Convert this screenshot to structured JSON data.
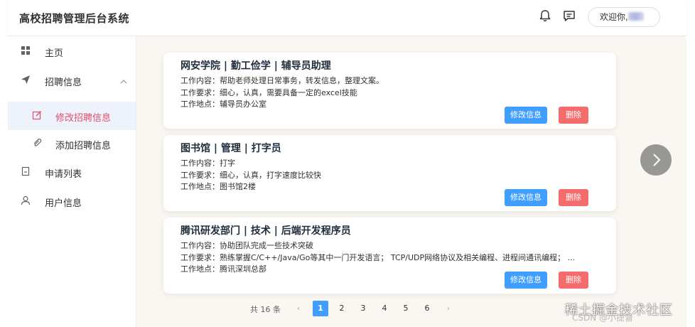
{
  "header": {
    "title": "高校招聘管理后台系统",
    "welcome_label": "欢迎你,"
  },
  "sidebar": {
    "items": [
      {
        "label": "主页",
        "icon": "grid-icon"
      },
      {
        "label": "招聘信息",
        "icon": "send-icon"
      },
      {
        "label": "修改招聘信息",
        "icon": "edit-icon"
      },
      {
        "label": "添加招聘信息",
        "icon": "paperclip-icon"
      },
      {
        "label": "申请列表",
        "icon": "notebook-icon"
      },
      {
        "label": "用户信息",
        "icon": "user-icon"
      }
    ]
  },
  "cards": [
    {
      "title": "网安学院 | 勤工俭学 | 辅导员助理",
      "content": "工作内容：帮助老师处理日常事务，转发信息，整理文案。",
      "requirement": "工作要求：细心，认真，需要具备一定的excel技能",
      "location": "工作地点：辅导员办公室"
    },
    {
      "title": "图书馆 | 管理 | 打字员",
      "content": "工作内容：打字",
      "requirement": "工作要求：细心，认真，打字速度比较快",
      "location": "工作地点：图书馆2楼"
    },
    {
      "title": "腾讯研发部门 | 技术 | 后端开发程序员",
      "content": "工作内容：协助团队完成一些技术突破",
      "requirement": "工作要求：熟练掌握C/C++/Java/Go等其中一门开发语言； TCP/UDP网络协议及相关编程、进程间通讯编程； ...",
      "location": "工作地点：腾讯深圳总部"
    }
  ],
  "buttons": {
    "edit": "修改信息",
    "delete": "删除"
  },
  "pagination": {
    "total": "共 16 条",
    "pages": [
      "1",
      "2",
      "3",
      "4",
      "5",
      "6"
    ],
    "current": "1",
    "prev": "‹",
    "next": "›"
  },
  "watermark": {
    "text": "稀土掘金技术社区",
    "sub": "CSDN @小提督"
  },
  "colors": {
    "primary": "#409eff",
    "danger": "#f56c6c",
    "active_text": "#e0506a",
    "main_bg": "#faf6f1"
  }
}
